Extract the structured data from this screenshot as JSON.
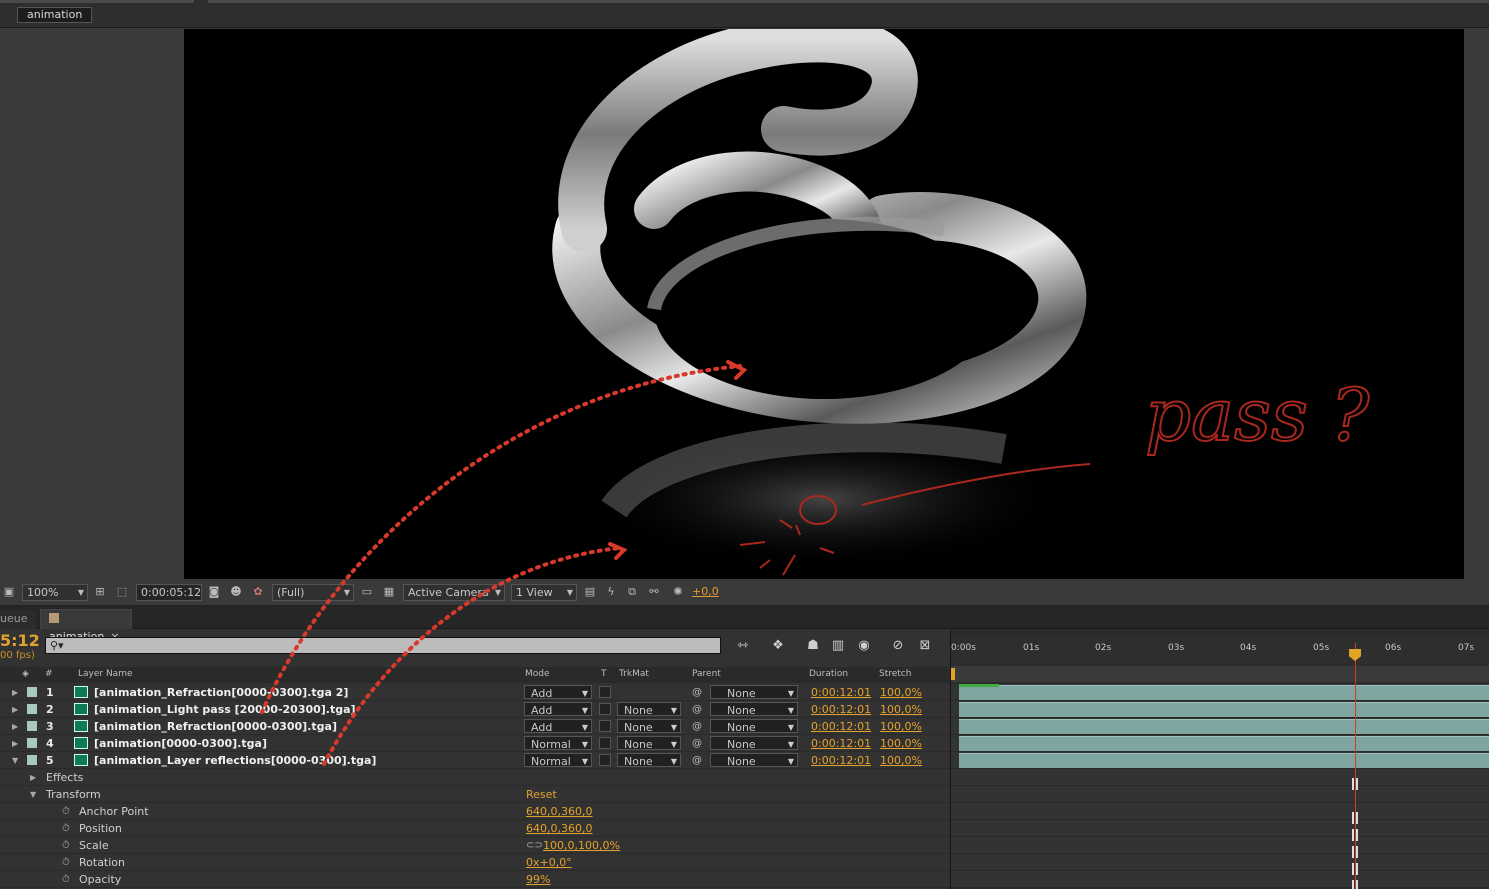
{
  "composition": {
    "tab_name": "animation",
    "zoom": "100%",
    "timecode": "0:00:05:12",
    "resolution": "(Full)",
    "camera": "Active Camera",
    "views": "1 View",
    "exposure": "+0,0"
  },
  "annotations": {
    "handwritten_text": "pass ?"
  },
  "timeline": {
    "tab_left_partial": "ueue",
    "tab_name": "animation",
    "tab_close": "×",
    "current_time": "5:12",
    "fps": "00 fps)",
    "search_placeholder": "⚲▾",
    "columns": {
      "num": "#",
      "layer_name": "Layer Name",
      "mode": "Mode",
      "t": "T",
      "trkmat": "TrkMat",
      "parent": "Parent",
      "duration": "Duration",
      "stretch": "Stretch"
    },
    "layers": [
      {
        "num": "1",
        "name": "[animation_Refraction[0000-0300].tga 2]",
        "mode": "Add",
        "trkmat": "",
        "parent": "None",
        "duration": "0:00:12:01",
        "stretch": "100,0%"
      },
      {
        "num": "2",
        "name": "[animation_Light pass [20000-20300].tga]",
        "mode": "Add",
        "trkmat": "None",
        "parent": "None",
        "duration": "0:00:12:01",
        "stretch": "100,0%"
      },
      {
        "num": "3",
        "name": "[animation_Refraction[0000-0300].tga]",
        "mode": "Add",
        "trkmat": "None",
        "parent": "None",
        "duration": "0:00:12:01",
        "stretch": "100,0%"
      },
      {
        "num": "4",
        "name": "[animation[0000-0300].tga]",
        "mode": "Normal",
        "trkmat": "None",
        "parent": "None",
        "duration": "0:00:12:01",
        "stretch": "100,0%"
      },
      {
        "num": "5",
        "name": "[animation_Layer reflections[0000-0300].tga]",
        "mode": "Normal",
        "trkmat": "None",
        "parent": "None",
        "duration": "0:00:12:01",
        "stretch": "100,0%"
      }
    ],
    "effects_label": "Effects",
    "transform_label": "Transform",
    "transform_reset": "Reset",
    "properties": [
      {
        "name": "Anchor Point",
        "value": "640,0,360,0"
      },
      {
        "name": "Position",
        "value": "640,0,360,0"
      },
      {
        "name": "Scale",
        "value": "100,0,100,0%"
      },
      {
        "name": "Rotation",
        "value": "0x+0,0°"
      },
      {
        "name": "Opacity",
        "value": "99%"
      }
    ],
    "ruler_ticks": [
      "0:00s",
      "01s",
      "02s",
      "03s",
      "04s",
      "05s",
      "06s",
      "07s"
    ]
  },
  "colors": {
    "accent_orange": "#e3a22d",
    "layer_bar": "#7fa5a0",
    "playhead": "#d63a2a",
    "annotation_red": "#d8392b"
  }
}
